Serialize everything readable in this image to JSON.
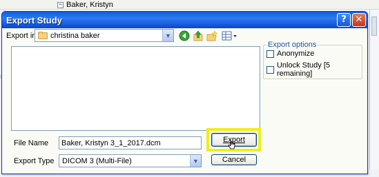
{
  "background": {
    "tree_item_toggle": "−",
    "tree_item_label": "Baker, Kristyn"
  },
  "dialog": {
    "title": "Export Study",
    "help_button": "?",
    "close_button": "✕",
    "export_in_label": "Export in",
    "export_in_folder": "christina baker",
    "toolbar_icons": [
      "back-icon",
      "up-folder-icon",
      "new-folder-icon",
      "view-menu-icon"
    ],
    "export_options": {
      "legend": "Export options",
      "anonymize_label": "Anonymize",
      "anonymize_checked": false,
      "unlock_label": "Unlock Study [5 remaining]",
      "unlock_checked": false
    },
    "file_name_label": "File Name",
    "file_name_value": "Baker, Kristyn 3_1_2017.dcm",
    "export_type_label": "Export Type",
    "export_type_value": "DICOM 3 (Multi-File)",
    "export_button": "Export",
    "cancel_button": "Cancel"
  },
  "colors": {
    "titlebar": "#0a5fe0",
    "highlight": "#f0ee17",
    "group_legend": "#1c52a8"
  }
}
